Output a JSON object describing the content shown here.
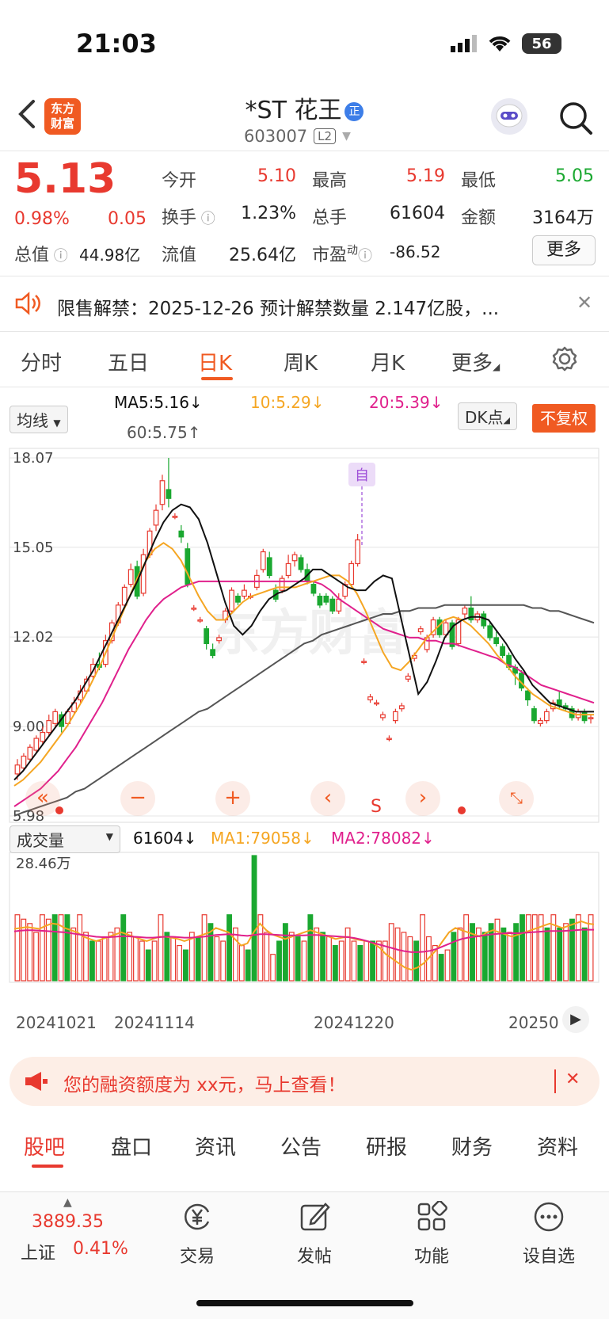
{
  "status_bar": {
    "time": "21:03",
    "battery": "56"
  },
  "header": {
    "logo_line1": "东方",
    "logo_line2": "财富",
    "stock_name": "*ST 花王",
    "name_badge": "正",
    "stock_code": "603007",
    "level": "L2"
  },
  "quote": {
    "price": "5.13",
    "change_pct": "0.98%",
    "change": "0.05",
    "open_label": "今开",
    "open": "5.10",
    "high_label": "最高",
    "high": "5.19",
    "low_label": "最低",
    "low": "5.05",
    "turnover_label": "换手",
    "turnover": "1.23%",
    "volume_label": "总手",
    "volume": "61604",
    "amount_label": "金额",
    "amount": "3164万",
    "mcap_label": "总值",
    "mcap": "44.98亿",
    "float_label": "流值",
    "float_cap": "25.64亿",
    "pe_label": "市盈",
    "pe_sup": "动",
    "pe": "-86.52",
    "more_button": "更多"
  },
  "notice": {
    "text": "限售解禁：2025-12-26 预计解禁数量 2.147亿股，..."
  },
  "chart_tabs": [
    "分时",
    "五日",
    "日K",
    "周K",
    "月K",
    "更多"
  ],
  "ma_row": {
    "dropdown": "均线",
    "ma5": "MA5:5.16↓",
    "ma10": "10:5.29↓",
    "ma20": "20:5.39↓",
    "ma60": "60:5.75↑",
    "dk_button": "DK点",
    "fq_button": "不复权"
  },
  "kline": {
    "y_labels": [
      "18.07",
      "15.05",
      "12.02",
      "9.00",
      "5.98"
    ],
    "watermark": "东方财富",
    "marker": "自",
    "s_marker": "S"
  },
  "volume_row": {
    "dropdown": "成交量",
    "vol": "61604↓",
    "ma1": "MA1:79058↓",
    "ma2": "MA2:78082↓",
    "max_label": "28.46万"
  },
  "x_labels": [
    "20241021",
    "20241114",
    "20241220",
    "20250"
  ],
  "colors": {
    "up": "#e8392f",
    "down": "#1aa830",
    "ma5": "#111111",
    "ma10": "#f5a623",
    "ma20": "#e0208c",
    "ma60": "#555555",
    "brand": "#f05a22"
  },
  "promo": {
    "text": "您的融资额度为 xx元，马上查看！"
  },
  "bottom_tabs": [
    "股吧",
    "盘口",
    "资讯",
    "公告",
    "研报",
    "财务",
    "资料"
  ],
  "index": {
    "value": "3889.35",
    "name": "上证",
    "pct": "0.41%"
  },
  "nav": [
    {
      "label": "交易",
      "icon": "yen-icon"
    },
    {
      "label": "发帖",
      "icon": "edit-icon"
    },
    {
      "label": "功能",
      "icon": "grid-icon"
    },
    {
      "label": "设自选",
      "icon": "more-icon"
    }
  ],
  "chart_data": {
    "type": "candlestick",
    "ylim": [
      5.98,
      18.07
    ],
    "candles": [
      [
        7.4,
        7.7,
        7.2,
        7.9
      ],
      [
        7.6,
        8.0,
        7.5,
        8.1
      ],
      [
        7.9,
        8.3,
        7.8,
        8.4
      ],
      [
        8.2,
        8.6,
        8.1,
        8.7
      ],
      [
        8.5,
        8.8,
        8.4,
        9.0
      ],
      [
        8.8,
        9.2,
        8.7,
        9.4
      ],
      [
        9.1,
        9.5,
        9.0,
        9.6
      ],
      [
        9.4,
        9.0,
        8.8,
        9.5
      ],
      [
        9.1,
        9.5,
        9.0,
        9.6
      ],
      [
        9.5,
        9.8,
        9.4,
        10.0
      ],
      [
        9.9,
        10.2,
        9.8,
        10.4
      ],
      [
        10.2,
        10.6,
        10.1,
        10.7
      ],
      [
        10.7,
        11.1,
        10.6,
        11.3
      ],
      [
        11.1,
        11.0,
        10.9,
        11.5
      ],
      [
        11.1,
        11.9,
        11.0,
        12.1
      ],
      [
        11.9,
        12.5,
        11.8,
        12.6
      ],
      [
        12.5,
        13.1,
        12.4,
        13.2
      ],
      [
        13.1,
        13.7,
        13.0,
        13.8
      ],
      [
        13.8,
        14.3,
        13.7,
        14.5
      ],
      [
        14.4,
        13.4,
        13.3,
        14.6
      ],
      [
        13.5,
        14.8,
        13.4,
        15.0
      ],
      [
        14.8,
        15.6,
        14.7,
        15.7
      ],
      [
        15.8,
        16.3,
        15.6,
        16.5
      ],
      [
        16.5,
        17.3,
        16.3,
        17.5
      ],
      [
        17.0,
        16.7,
        16.4,
        18.07
      ],
      [
        16.1,
        16.1,
        16.0,
        16.2
      ],
      [
        15.6,
        15.4,
        15.2,
        15.8
      ],
      [
        15.0,
        13.8,
        13.7,
        15.2
      ],
      [
        13.0,
        13.0,
        12.9,
        13.1
      ],
      [
        12.6,
        12.6,
        12.5,
        12.7
      ],
      [
        12.3,
        11.8,
        11.6,
        12.4
      ],
      [
        11.6,
        11.4,
        11.3,
        11.8
      ],
      [
        11.9,
        12.0,
        11.8,
        12.1
      ],
      [
        12.6,
        12.9,
        12.5,
        13.0
      ],
      [
        12.9,
        13.6,
        12.8,
        13.7
      ],
      [
        13.4,
        13.2,
        13.1,
        13.5
      ],
      [
        13.4,
        13.6,
        13.3,
        13.8
      ],
      [
        13.4,
        13.4,
        13.3,
        13.5
      ],
      [
        13.7,
        14.1,
        13.6,
        14.3
      ],
      [
        14.3,
        14.9,
        14.2,
        15.0
      ],
      [
        14.7,
        14.1,
        14.0,
        14.9
      ],
      [
        13.6,
        13.3,
        13.2,
        13.8
      ],
      [
        13.6,
        14.0,
        13.5,
        14.1
      ],
      [
        14.1,
        14.5,
        14.0,
        14.8
      ],
      [
        14.6,
        14.8,
        14.4,
        14.9
      ],
      [
        14.7,
        14.3,
        14.2,
        14.8
      ],
      [
        14.3,
        13.9,
        13.8,
        14.5
      ],
      [
        13.8,
        13.5,
        13.4,
        13.9
      ],
      [
        13.4,
        13.1,
        13.0,
        13.5
      ],
      [
        13.4,
        13.2,
        13.1,
        13.5
      ],
      [
        13.3,
        12.9,
        12.8,
        13.4
      ],
      [
        12.9,
        13.3,
        12.8,
        13.5
      ],
      [
        13.4,
        13.8,
        13.3,
        13.9
      ],
      [
        13.8,
        14.5,
        13.7,
        14.6
      ],
      [
        14.5,
        15.3,
        14.4,
        15.5
      ],
      [
        11.2,
        11.2,
        11.1,
        11.3
      ],
      [
        9.9,
        10.0,
        9.8,
        10.1
      ],
      [
        9.8,
        9.8,
        9.7,
        9.9
      ],
      [
        9.3,
        9.4,
        9.2,
        9.5
      ],
      [
        8.6,
        8.6,
        8.5,
        8.7
      ],
      [
        9.2,
        9.5,
        9.1,
        9.6
      ],
      [
        9.6,
        9.7,
        9.5,
        9.8
      ],
      [
        10.6,
        10.7,
        10.5,
        10.8
      ],
      [
        11.3,
        11.4,
        11.2,
        11.5
      ],
      [
        12.2,
        12.3,
        12.1,
        12.4
      ],
      [
        11.6,
        12.0,
        11.5,
        12.1
      ],
      [
        12.1,
        12.6,
        12.0,
        12.7
      ],
      [
        12.6,
        12.1,
        12.0,
        12.7
      ],
      [
        12.1,
        12.5,
        12.0,
        12.6
      ],
      [
        12.5,
        11.7,
        11.6,
        12.6
      ],
      [
        11.8,
        12.6,
        11.7,
        12.7
      ],
      [
        12.8,
        13.0,
        12.6,
        13.1
      ],
      [
        13.0,
        12.6,
        12.5,
        13.4
      ],
      [
        12.6,
        12.8,
        12.5,
        12.9
      ],
      [
        12.8,
        12.4,
        12.3,
        12.9
      ],
      [
        12.4,
        12.0,
        11.9,
        12.5
      ],
      [
        12.0,
        11.8,
        11.7,
        12.2
      ],
      [
        11.7,
        11.4,
        11.3,
        11.8
      ],
      [
        11.4,
        11.0,
        10.9,
        11.5
      ],
      [
        11.0,
        10.8,
        10.4,
        11.1
      ],
      [
        10.8,
        10.3,
        10.2,
        10.9
      ],
      [
        10.2,
        9.9,
        9.7,
        10.3
      ],
      [
        9.6,
        9.2,
        9.1,
        9.7
      ],
      [
        9.1,
        9.2,
        9.0,
        9.3
      ],
      [
        9.2,
        9.5,
        9.1,
        9.6
      ],
      [
        9.6,
        9.8,
        9.5,
        9.9
      ],
      [
        9.9,
        9.7,
        9.6,
        10.2
      ],
      [
        9.7,
        9.6,
        9.5,
        9.8
      ],
      [
        9.6,
        9.3,
        9.2,
        9.7
      ],
      [
        9.3,
        9.5,
        9.2,
        9.6
      ],
      [
        9.5,
        9.2,
        9.1,
        9.6
      ],
      [
        9.3,
        9.3,
        9.1,
        9.4
      ]
    ],
    "ma5": [
      7.2,
      7.5,
      7.9,
      8.3,
      8.7,
      9.1,
      9.5,
      9.9,
      10.4,
      10.9,
      11.5,
      12.1,
      12.7,
      13.3,
      13.9,
      14.6,
      15.3,
      15.9,
      16.3,
      16.5,
      16.4,
      16.0,
      15.2,
      14.2,
      13.2,
      12.4,
      12.1,
      12.4,
      12.9,
      13.3,
      13.5,
      13.6,
      13.8,
      14.0,
      14.3,
      14.3,
      14.1,
      13.9,
      13.7,
      13.6,
      13.6,
      13.9,
      14.1,
      14.0,
      12.7,
      11.4,
      10.1,
      10.5,
      11.2,
      12.0,
      12.4,
      12.6,
      12.7,
      12.7,
      12.6,
      12.2,
      11.8,
      11.3,
      10.9,
      10.4,
      10.1,
      9.8,
      9.7,
      9.6,
      9.5,
      9.5,
      9.5
    ],
    "ma10": [
      7.0,
      7.2,
      7.5,
      7.8,
      8.2,
      8.6,
      9.0,
      9.5,
      10.0,
      10.6,
      11.2,
      11.9,
      12.6,
      13.3,
      14.0,
      14.6,
      15.0,
      15.2,
      15.0,
      14.6,
      14.0,
      13.4,
      12.9,
      12.6,
      12.6,
      12.9,
      13.2,
      13.4,
      13.5,
      13.6,
      13.7,
      13.7,
      13.7,
      13.8,
      13.9,
      14.0,
      14.1,
      14.1,
      13.9,
      13.5,
      12.9,
      12.2,
      11.5,
      11.0,
      10.9,
      11.2,
      11.6,
      12.0,
      12.3,
      12.6,
      12.7,
      12.6,
      12.4,
      12.1,
      11.8,
      11.4,
      11.1,
      10.7,
      10.4,
      10.1,
      9.9,
      9.7,
      9.6,
      9.5,
      9.4,
      9.4,
      9.4
    ],
    "ma20": [
      6.3,
      6.5,
      6.7,
      6.9,
      7.2,
      7.5,
      7.9,
      8.3,
      8.8,
      9.3,
      9.8,
      10.4,
      11.0,
      11.6,
      12.1,
      12.6,
      13.0,
      13.3,
      13.5,
      13.7,
      13.8,
      13.9,
      13.9,
      13.9,
      13.9,
      13.9,
      13.9,
      13.9,
      13.9,
      13.9,
      13.9,
      13.9,
      13.9,
      13.9,
      13.9,
      13.8,
      13.6,
      13.3,
      13.1,
      12.9,
      12.7,
      12.5,
      12.3,
      12.2,
      12.1,
      12.0,
      12.0,
      11.9,
      11.9,
      11.8,
      11.8,
      11.7,
      11.6,
      11.5,
      11.4,
      11.3,
      11.1,
      11.0,
      10.8,
      10.6,
      10.4,
      10.3,
      10.2,
      10.1,
      10.0,
      9.9,
      9.8
    ],
    "ma60": [
      5.98,
      6.1,
      6.2,
      6.3,
      6.4,
      6.5,
      6.6,
      6.8,
      6.9,
      7.1,
      7.3,
      7.5,
      7.7,
      7.9,
      8.1,
      8.3,
      8.5,
      8.7,
      8.9,
      9.1,
      9.3,
      9.5,
      9.6,
      9.8,
      10.0,
      10.2,
      10.4,
      10.6,
      10.8,
      11.0,
      11.2,
      11.4,
      11.6,
      11.8,
      11.9,
      12.1,
      12.2,
      12.3,
      12.4,
      12.5,
      12.6,
      12.7,
      12.8,
      12.8,
      12.9,
      12.9,
      13.0,
      13.0,
      13.0,
      13.1,
      13.1,
      13.1,
      13.1,
      13.1,
      13.1,
      13.1,
      13.1,
      13.1,
      13.1,
      13.0,
      13.0,
      12.9,
      12.9,
      12.8,
      12.7,
      12.6,
      12.5
    ],
    "volume_ylim": [
      0,
      284600
    ],
    "volume": [
      150000,
      140000,
      130000,
      110000,
      150000,
      140000,
      150000,
      150000,
      150000,
      120000,
      150000,
      110000,
      90000,
      90000,
      100000,
      110000,
      120000,
      150000,
      110000,
      100000,
      90000,
      70000,
      90000,
      150000,
      110000,
      100000,
      80000,
      70000,
      110000,
      100000,
      150000,
      130000,
      100000,
      90000,
      150000,
      120000,
      80000,
      70000,
      284600,
      150000,
      110000,
      60000,
      90000,
      130000,
      110000,
      100000,
      90000,
      150000,
      120000,
      110000,
      100000,
      80000,
      90000,
      120000,
      90000,
      80000,
      90000,
      90000,
      90000,
      90000,
      130000,
      120000,
      110000,
      100000,
      90000,
      150000,
      100000,
      80000,
      60000,
      70000,
      110000,
      120000,
      150000,
      130000,
      120000,
      110000,
      130000,
      140000,
      120000,
      110000,
      130000,
      150000,
      150000,
      150000,
      150000,
      120000,
      150000,
      120000,
      130000,
      140000,
      150000,
      120000,
      150000
    ],
    "volume_dir": [
      1,
      1,
      1,
      1,
      1,
      1,
      0,
      1,
      0,
      1,
      1,
      1,
      0,
      1,
      1,
      1,
      1,
      0,
      1,
      1,
      1,
      0,
      1,
      1,
      0,
      1,
      1,
      0,
      1,
      0,
      1,
      0,
      1,
      1,
      0,
      1,
      1,
      0,
      0,
      1,
      1,
      1,
      0,
      0,
      1,
      0,
      1,
      0,
      1,
      0,
      1,
      0,
      1,
      1,
      1,
      0,
      1,
      0,
      1,
      1,
      1,
      1,
      1,
      1,
      0,
      1,
      1,
      1,
      0,
      1,
      0,
      1,
      1,
      0,
      1,
      0,
      0,
      1,
      0,
      1,
      0,
      0,
      1,
      1,
      1,
      0,
      1,
      0,
      1,
      0,
      1,
      0,
      1
    ],
    "vol_ma1": [
      118000,
      120000,
      122000,
      120000,
      118000,
      125000,
      130000,
      128000,
      120000,
      115000,
      110000,
      100000,
      95000,
      90000,
      95000,
      100000,
      105000,
      110000,
      105000,
      100000,
      95000,
      90000,
      95000,
      100000,
      100000,
      98000,
      95000,
      90000,
      95000,
      100000,
      105000,
      110000,
      120000,
      115000,
      110000,
      95000,
      80000,
      85000,
      110000,
      130000,
      115000,
      105000,
      100000,
      95000,
      100000,
      105000,
      110000,
      115000,
      110000,
      105000,
      100000,
      95000,
      98000,
      100000,
      95000,
      92000,
      90000,
      85000,
      75000,
      60000,
      50000,
      40000,
      30000,
      25000,
      30000,
      40000,
      55000,
      70000,
      90000,
      110000,
      120000,
      115000,
      110000,
      105000,
      100000,
      110000,
      115000,
      110000,
      105000,
      100000,
      105000,
      110000,
      115000,
      120000,
      125000,
      130000,
      125000,
      120000,
      125000,
      130000,
      135000,
      130000,
      128000
    ],
    "vol_ma2": [
      112000,
      114000,
      115000,
      115000,
      114000,
      113000,
      112000,
      111000,
      110000,
      108000,
      106000,
      104000,
      102000,
      100000,
      99000,
      99000,
      100000,
      101000,
      101000,
      100000,
      99000,
      98000,
      98000,
      99000,
      100000,
      100000,
      99000,
      98000,
      98000,
      99000,
      100000,
      102000,
      104000,
      105000,
      106000,
      105000,
      103000,
      102000,
      104000,
      106000,
      106000,
      105000,
      104000,
      103000,
      103000,
      103000,
      103000,
      104000,
      104000,
      103000,
      102000,
      101000,
      100000,
      99000,
      97000,
      94000,
      90000,
      86000,
      82000,
      78000,
      74000,
      70000,
      67000,
      65000,
      65000,
      66000,
      68000,
      72000,
      78000,
      84000,
      90000,
      95000,
      98000,
      100000,
      102000,
      104000,
      106000,
      107000,
      108000,
      108000,
      108000,
      109000,
      110000,
      111000,
      112000,
      113000,
      113000,
      113000,
      114000,
      115000,
      116000,
      116000,
      116000
    ]
  }
}
